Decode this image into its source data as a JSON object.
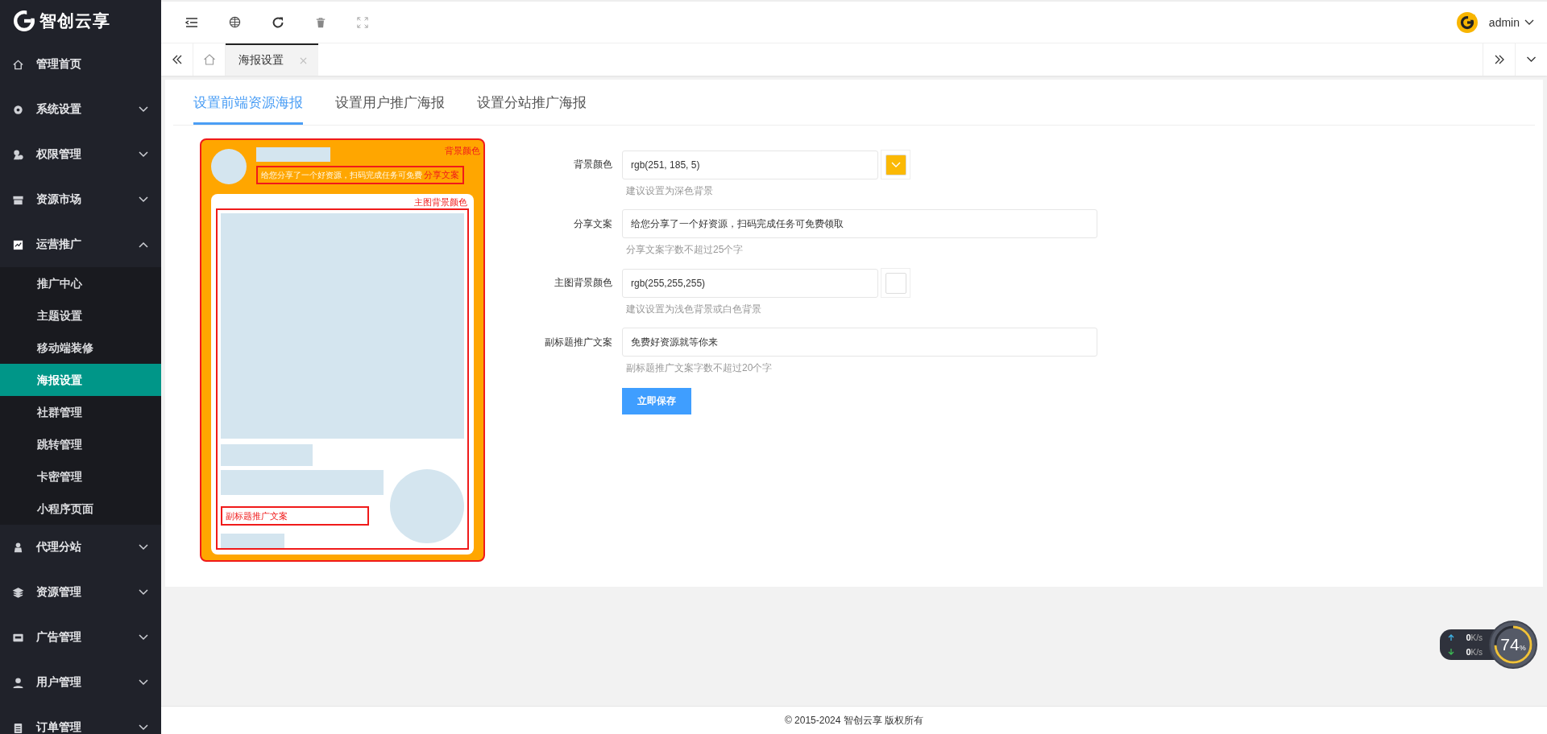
{
  "brand": {
    "name": "智创云享"
  },
  "sidebar": {
    "items": [
      {
        "label": "管理首页",
        "kind": "link"
      },
      {
        "label": "系统设置",
        "kind": "group",
        "expanded": false
      },
      {
        "label": "权限管理",
        "kind": "group",
        "expanded": false
      },
      {
        "label": "资源市场",
        "kind": "group",
        "expanded": false
      },
      {
        "label": "运营推广",
        "kind": "group",
        "expanded": true,
        "children": [
          {
            "label": "推广中心",
            "selected": false
          },
          {
            "label": "主题设置",
            "selected": false
          },
          {
            "label": "移动端装修",
            "selected": false
          },
          {
            "label": "海报设置",
            "selected": true
          },
          {
            "label": "社群管理",
            "selected": false
          },
          {
            "label": "跳转管理",
            "selected": false
          },
          {
            "label": "卡密管理",
            "selected": false
          },
          {
            "label": "小程序页面",
            "selected": false
          }
        ]
      },
      {
        "label": "代理分站",
        "kind": "group",
        "expanded": false
      },
      {
        "label": "资源管理",
        "kind": "group",
        "expanded": false
      },
      {
        "label": "广告管理",
        "kind": "group",
        "expanded": false
      },
      {
        "label": "用户管理",
        "kind": "group",
        "expanded": false
      },
      {
        "label": "订单管理",
        "kind": "group",
        "expanded": false
      }
    ]
  },
  "header": {
    "user": "admin"
  },
  "page_tabs": [
    {
      "label": "海报设置",
      "selected": true
    }
  ],
  "content_tabs": [
    {
      "label": "设置前端资源海报",
      "selected": true
    },
    {
      "label": "设置用户推广海报",
      "selected": false
    },
    {
      "label": "设置分站推广海报",
      "selected": false
    }
  ],
  "poster_preview": {
    "background_label": "背景颜色",
    "share_text": "给您分享了一个好资源，扫码完成任务可免费",
    "share_label": "分享文案",
    "main_background_label": "主图背景颜色",
    "subtitle_label": "副标题推广文案"
  },
  "form": {
    "fields": [
      {
        "kind": "color",
        "label": "背景颜色",
        "value": "rgb(251, 185, 5)",
        "color": "#fbb905",
        "show_caret": true,
        "hint": "建议设置为深色背景"
      },
      {
        "kind": "text",
        "label": "分享文案",
        "value": "给您分享了一个好资源，扫码完成任务可免费领取",
        "hint": "分享文案字数不超过25个字"
      },
      {
        "kind": "color",
        "label": "主图背景颜色",
        "value": "rgb(255,255,255)",
        "color": "#ffffff",
        "hint": "建议设置为浅色背景或白色背景"
      },
      {
        "kind": "text",
        "label": "副标题推广文案",
        "value": "免费好资源就等你来",
        "hint": "副标题推广文案字数不超过20个字"
      }
    ],
    "submit": "立即保存"
  },
  "network_widget": {
    "upload": "0",
    "upload_unit": "K/s",
    "download": "0",
    "download_unit": "K/s",
    "percent": "74",
    "percent_unit": "%",
    "level": 0.74
  },
  "footer": {
    "text": "© 2015-2024 智创云享 版权所有"
  }
}
